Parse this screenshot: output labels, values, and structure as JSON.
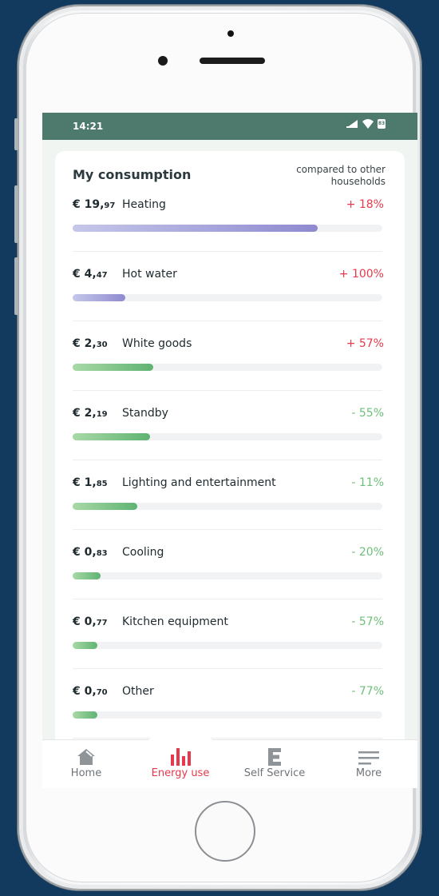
{
  "status_bar": {
    "time": "14:21",
    "battery": "83"
  },
  "consumption": {
    "title": "My consumption",
    "compare_label": "compared to other households",
    "items": [
      {
        "price_main": "€ 19,",
        "price_cents": "97",
        "label": "Heating",
        "change": "+ 18%",
        "direction": "up",
        "bar_fraction": 0.79,
        "bar_color": "purple"
      },
      {
        "price_main": "€ 4,",
        "price_cents": "47",
        "label": "Hot water",
        "change": "+ 100%",
        "direction": "up",
        "bar_fraction": 0.17,
        "bar_color": "purple"
      },
      {
        "price_main": "€ 2,",
        "price_cents": "30",
        "label": "White goods",
        "change": "+ 57%",
        "direction": "up",
        "bar_fraction": 0.26,
        "bar_color": "green"
      },
      {
        "price_main": "€ 2,",
        "price_cents": "19",
        "label": "Standby",
        "change": "- 55%",
        "direction": "down",
        "bar_fraction": 0.25,
        "bar_color": "green"
      },
      {
        "price_main": "€ 1,",
        "price_cents": "85",
        "label": "Lighting and entertainment",
        "change": "- 11%",
        "direction": "down",
        "bar_fraction": 0.21,
        "bar_color": "green"
      },
      {
        "price_main": "€ 0,",
        "price_cents": "83",
        "label": "Cooling",
        "change": "- 20%",
        "direction": "down",
        "bar_fraction": 0.09,
        "bar_color": "green"
      },
      {
        "price_main": "€ 0,",
        "price_cents": "77",
        "label": "Kitchen equipment",
        "change": "- 57%",
        "direction": "down",
        "bar_fraction": 0.08,
        "bar_color": "green"
      },
      {
        "price_main": "€ 0,",
        "price_cents": "70",
        "label": "Other",
        "change": "- 77%",
        "direction": "down",
        "bar_fraction": 0.08,
        "bar_color": "green"
      }
    ]
  },
  "colors": {
    "up": "#e6394d",
    "down": "#6fbf7c",
    "status_bar": "#4d7a6c",
    "active_nav": "#e6394d"
  },
  "nav": {
    "items": [
      {
        "label": "Home",
        "icon": "home-icon",
        "active": false
      },
      {
        "label": "Energy use",
        "icon": "bar-chart-icon",
        "active": true
      },
      {
        "label": "Self Service",
        "icon": "self-service-e-icon",
        "active": false
      },
      {
        "label": "More",
        "icon": "menu-icon",
        "active": false
      }
    ]
  }
}
